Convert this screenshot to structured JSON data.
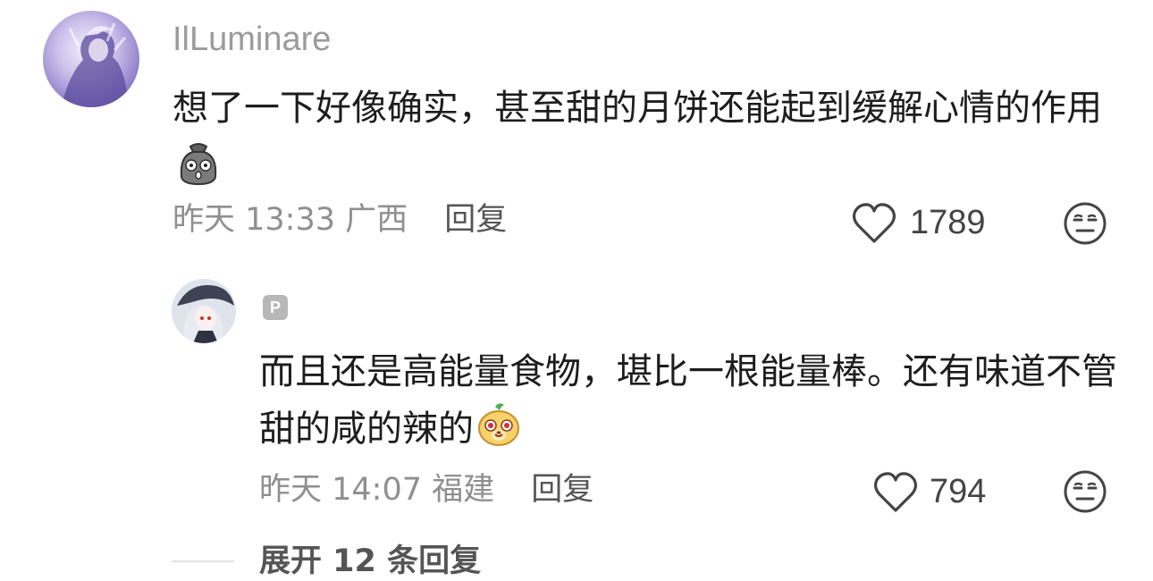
{
  "comments": [
    {
      "username": "IlLuminare",
      "text": "想了一下好像确实，甚至甜的月饼还能起到缓解心情的作用",
      "emoji": "pouch-shocked-emoji",
      "time": "昨天 13:33",
      "location": "广西",
      "reply_label": "回复",
      "likes": "1789",
      "avatar": "purple-anime-avatar"
    },
    {
      "badge": "P",
      "text": "而且还是高能量食物，堪比一根能量棒。还有味道不管甜的咸的辣的",
      "emoji": "dog-face-emoji",
      "time": "昨天 14:07",
      "location": "福建",
      "reply_label": "回复",
      "likes": "794",
      "avatar": "witch-hat-anime-avatar"
    }
  ],
  "expand_replies": "展开 12 条回复",
  "icons": {
    "like": "heart-icon",
    "dislike": "unamused-face-icon"
  },
  "colors": {
    "text": "#1d1d1d",
    "meta": "#8f8f8f",
    "username": "#9b9b9b"
  }
}
